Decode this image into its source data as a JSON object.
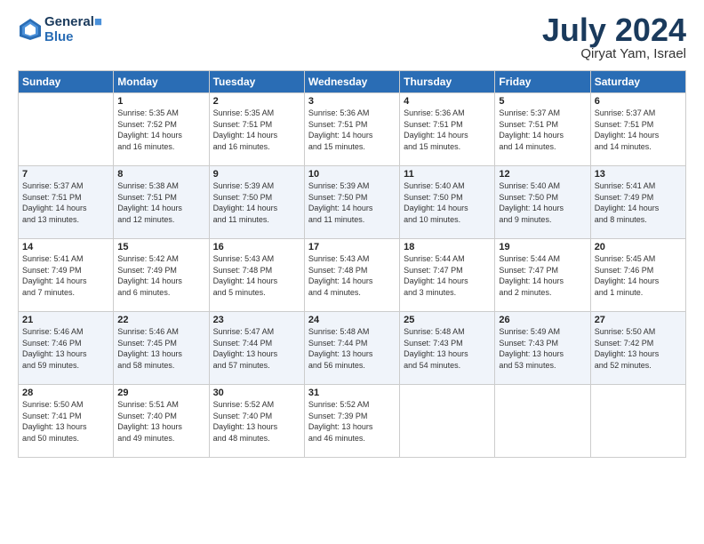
{
  "header": {
    "logo_line1": "General",
    "logo_line2": "Blue",
    "month": "July 2024",
    "location": "Qiryat Yam, Israel"
  },
  "days_of_week": [
    "Sunday",
    "Monday",
    "Tuesday",
    "Wednesday",
    "Thursday",
    "Friday",
    "Saturday"
  ],
  "weeks": [
    [
      {
        "day": "",
        "info": ""
      },
      {
        "day": "1",
        "info": "Sunrise: 5:35 AM\nSunset: 7:52 PM\nDaylight: 14 hours\nand 16 minutes."
      },
      {
        "day": "2",
        "info": "Sunrise: 5:35 AM\nSunset: 7:51 PM\nDaylight: 14 hours\nand 16 minutes."
      },
      {
        "day": "3",
        "info": "Sunrise: 5:36 AM\nSunset: 7:51 PM\nDaylight: 14 hours\nand 15 minutes."
      },
      {
        "day": "4",
        "info": "Sunrise: 5:36 AM\nSunset: 7:51 PM\nDaylight: 14 hours\nand 15 minutes."
      },
      {
        "day": "5",
        "info": "Sunrise: 5:37 AM\nSunset: 7:51 PM\nDaylight: 14 hours\nand 14 minutes."
      },
      {
        "day": "6",
        "info": "Sunrise: 5:37 AM\nSunset: 7:51 PM\nDaylight: 14 hours\nand 14 minutes."
      }
    ],
    [
      {
        "day": "7",
        "info": "Sunrise: 5:37 AM\nSunset: 7:51 PM\nDaylight: 14 hours\nand 13 minutes."
      },
      {
        "day": "8",
        "info": "Sunrise: 5:38 AM\nSunset: 7:51 PM\nDaylight: 14 hours\nand 12 minutes."
      },
      {
        "day": "9",
        "info": "Sunrise: 5:39 AM\nSunset: 7:50 PM\nDaylight: 14 hours\nand 11 minutes."
      },
      {
        "day": "10",
        "info": "Sunrise: 5:39 AM\nSunset: 7:50 PM\nDaylight: 14 hours\nand 11 minutes."
      },
      {
        "day": "11",
        "info": "Sunrise: 5:40 AM\nSunset: 7:50 PM\nDaylight: 14 hours\nand 10 minutes."
      },
      {
        "day": "12",
        "info": "Sunrise: 5:40 AM\nSunset: 7:50 PM\nDaylight: 14 hours\nand 9 minutes."
      },
      {
        "day": "13",
        "info": "Sunrise: 5:41 AM\nSunset: 7:49 PM\nDaylight: 14 hours\nand 8 minutes."
      }
    ],
    [
      {
        "day": "14",
        "info": "Sunrise: 5:41 AM\nSunset: 7:49 PM\nDaylight: 14 hours\nand 7 minutes."
      },
      {
        "day": "15",
        "info": "Sunrise: 5:42 AM\nSunset: 7:49 PM\nDaylight: 14 hours\nand 6 minutes."
      },
      {
        "day": "16",
        "info": "Sunrise: 5:43 AM\nSunset: 7:48 PM\nDaylight: 14 hours\nand 5 minutes."
      },
      {
        "day": "17",
        "info": "Sunrise: 5:43 AM\nSunset: 7:48 PM\nDaylight: 14 hours\nand 4 minutes."
      },
      {
        "day": "18",
        "info": "Sunrise: 5:44 AM\nSunset: 7:47 PM\nDaylight: 14 hours\nand 3 minutes."
      },
      {
        "day": "19",
        "info": "Sunrise: 5:44 AM\nSunset: 7:47 PM\nDaylight: 14 hours\nand 2 minutes."
      },
      {
        "day": "20",
        "info": "Sunrise: 5:45 AM\nSunset: 7:46 PM\nDaylight: 14 hours\nand 1 minute."
      }
    ],
    [
      {
        "day": "21",
        "info": "Sunrise: 5:46 AM\nSunset: 7:46 PM\nDaylight: 13 hours\nand 59 minutes."
      },
      {
        "day": "22",
        "info": "Sunrise: 5:46 AM\nSunset: 7:45 PM\nDaylight: 13 hours\nand 58 minutes."
      },
      {
        "day": "23",
        "info": "Sunrise: 5:47 AM\nSunset: 7:44 PM\nDaylight: 13 hours\nand 57 minutes."
      },
      {
        "day": "24",
        "info": "Sunrise: 5:48 AM\nSunset: 7:44 PM\nDaylight: 13 hours\nand 56 minutes."
      },
      {
        "day": "25",
        "info": "Sunrise: 5:48 AM\nSunset: 7:43 PM\nDaylight: 13 hours\nand 54 minutes."
      },
      {
        "day": "26",
        "info": "Sunrise: 5:49 AM\nSunset: 7:43 PM\nDaylight: 13 hours\nand 53 minutes."
      },
      {
        "day": "27",
        "info": "Sunrise: 5:50 AM\nSunset: 7:42 PM\nDaylight: 13 hours\nand 52 minutes."
      }
    ],
    [
      {
        "day": "28",
        "info": "Sunrise: 5:50 AM\nSunset: 7:41 PM\nDaylight: 13 hours\nand 50 minutes."
      },
      {
        "day": "29",
        "info": "Sunrise: 5:51 AM\nSunset: 7:40 PM\nDaylight: 13 hours\nand 49 minutes."
      },
      {
        "day": "30",
        "info": "Sunrise: 5:52 AM\nSunset: 7:40 PM\nDaylight: 13 hours\nand 48 minutes."
      },
      {
        "day": "31",
        "info": "Sunrise: 5:52 AM\nSunset: 7:39 PM\nDaylight: 13 hours\nand 46 minutes."
      },
      {
        "day": "",
        "info": ""
      },
      {
        "day": "",
        "info": ""
      },
      {
        "day": "",
        "info": ""
      }
    ]
  ]
}
